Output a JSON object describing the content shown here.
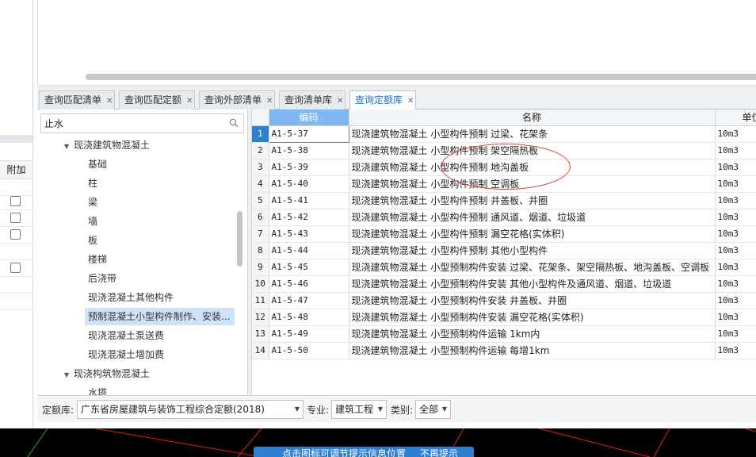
{
  "left_panel": {
    "header_label": "附加"
  },
  "tabs": [
    {
      "label": "查询匹配清单"
    },
    {
      "label": "查询匹配定额"
    },
    {
      "label": "查询外部清单"
    },
    {
      "label": "查询清单库"
    },
    {
      "label": "查询定额库",
      "active": true
    }
  ],
  "search": {
    "value": "止水"
  },
  "tree": [
    {
      "label": "现浇建筑物混凝土",
      "level": 0,
      "expanded": true
    },
    {
      "label": "基础",
      "level": 1
    },
    {
      "label": "柱",
      "level": 1
    },
    {
      "label": "梁",
      "level": 1
    },
    {
      "label": "墙",
      "level": 1
    },
    {
      "label": "板",
      "level": 1
    },
    {
      "label": "楼梯",
      "level": 1
    },
    {
      "label": "后浇带",
      "level": 1
    },
    {
      "label": "现浇混凝土其他构件",
      "level": 1
    },
    {
      "label": "预制混凝土小型构件制作、安装...",
      "level": 1,
      "selected": true
    },
    {
      "label": "现浇混凝土泵送费",
      "level": 1
    },
    {
      "label": "现浇混凝土增加费",
      "level": 1
    },
    {
      "label": "现浇构筑物混凝土",
      "level": 0,
      "expanded": true
    },
    {
      "label": "水塔",
      "level": 1
    }
  ],
  "grid": {
    "headers": {
      "code": "编码",
      "name": "名称",
      "unit": "单位"
    },
    "rows": [
      {
        "num": "1",
        "code": "A1-5-37",
        "name": "现浇建筑物混凝土 小型构件预制 过梁、花架条",
        "unit": "10m3"
      },
      {
        "num": "2",
        "code": "A1-5-38",
        "name": "现浇建筑物混凝土 小型构件预制 架空隔热板",
        "unit": "10m3"
      },
      {
        "num": "3",
        "code": "A1-5-39",
        "name": "现浇建筑物混凝土 小型构件预制 地沟盖板",
        "unit": "10m3"
      },
      {
        "num": "4",
        "code": "A1-5-40",
        "name": "现浇建筑物混凝土 小型构件预制 空调板",
        "unit": "10m3"
      },
      {
        "num": "5",
        "code": "A1-5-41",
        "name": "现浇建筑物混凝土 小型构件预制 井盖板、井圈",
        "unit": "10m3"
      },
      {
        "num": "6",
        "code": "A1-5-42",
        "name": "现浇建筑物混凝土 小型构件预制 通风道、烟道、垃圾道",
        "unit": "10m3"
      },
      {
        "num": "7",
        "code": "A1-5-43",
        "name": "现浇建筑物混凝土 小型构件预制 漏空花格(实体积)",
        "unit": "10m3"
      },
      {
        "num": "8",
        "code": "A1-5-44",
        "name": "现浇建筑物混凝土 小型构件预制 其他小型构件",
        "unit": "10m3"
      },
      {
        "num": "9",
        "code": "A1-5-45",
        "name": "现浇建筑物混凝土 小型预制构件安装 过梁、花架条、架空隔热板、地沟盖板、空调板",
        "unit": "10m3"
      },
      {
        "num": "10",
        "code": "A1-5-46",
        "name": "现浇建筑物混凝土 小型预制构件安装 其他小型构件及通风道、烟道、垃圾道",
        "unit": "10m3"
      },
      {
        "num": "11",
        "code": "A1-5-47",
        "name": "现浇建筑物混凝土 小型预制构件安装 井盖板、井圈",
        "unit": "10m3"
      },
      {
        "num": "12",
        "code": "A1-5-48",
        "name": "现浇建筑物混凝土 小型预制构件安装 漏空花格(实体积)",
        "unit": "10m3"
      },
      {
        "num": "13",
        "code": "A1-5-49",
        "name": "现浇建筑物混凝土 小型预制构件运输 1km内",
        "unit": "10m3"
      },
      {
        "num": "14",
        "code": "A1-5-50",
        "name": "现浇建筑物混凝土 小型预制构件运输 每增1km",
        "unit": "10m3"
      }
    ]
  },
  "bottom": {
    "quota_label": "定额库:",
    "quota_value": "广东省房屋建筑与装饰工程综合定额(2018)",
    "major_label": "专业:",
    "major_value": "建筑工程",
    "category_label": "类别:",
    "category_value": "全部"
  },
  "tip": {
    "text": "点击图标可调节提示信息位置",
    "dismiss": "不再提示"
  },
  "colors": {
    "accent": "#2f7fd1",
    "selection": "#cfe3f8",
    "annotation": "#e23a3a"
  }
}
